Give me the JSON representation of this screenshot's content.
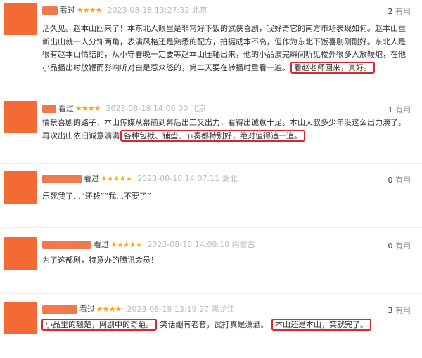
{
  "reviews": [
    {
      "watched": "看过",
      "stars": "★★★★",
      "meta": "2023-08-18 13:27:32 北京",
      "useful_count": "2",
      "useful_label": "有用",
      "text": "活久见。赵本山回来了！本东北人眼里是非常好下饭的武侠喜剧，我好奇它的南方市场表现如何。赵本山重新出山就一人分饰两角，表演风格还是熟悉的配方，拍摄成本不高，但作为东北下饭喜剧刚刚好。东北人是很有赵本山情结的，从小守春晚一定要等赵本山压轴出来，他的小品演完瞬间听见楼外很多人放鞭炮，在他小品播出时放鞭而影响听对白是惹众怒的，第二天要在转播时重看一遍。",
      "highlight": "看赵老师回来，真好。"
    },
    {
      "watched": "看过",
      "stars": "★★★★",
      "meta": "2023-08-18 14:06:00 北京",
      "useful_count": "1",
      "useful_label": "有用",
      "text": "情景喜剧的路子，本山传媒从幕前到幕后出工又出力，看得出诚意十足。本山大叔多少年没这么出力演了，再次出山依旧诚意满满",
      "highlight": "各种包袱、铺垫、节奏都特别好，绝对值得追一追。"
    },
    {
      "watched": "看过",
      "stars": "★★★★★",
      "meta": "2023-08-18 14:07:11 湖北",
      "useful_count": "0",
      "useful_label": "有用",
      "text": "乐死我了…“还钱”“我…不要了”"
    },
    {
      "watched": "看过",
      "stars": "★★★★★",
      "meta": "2023-08-18 14:09:18 内蒙古",
      "useful_count": "0",
      "useful_label": "有用",
      "text": "为了这部剧，特意办的腾讯会员！"
    },
    {
      "watched": "看过",
      "stars": "★★★★",
      "meta": "2023-08-18 13:19:27 黑龙江",
      "useful_count": "3",
      "useful_label": "有用",
      "hl1": "小品里的翘楚，网剧中的奇葩。",
      "mid": "笑话绷有老套，武打真是潇洒。",
      "hl2": "本山还是本山，笑就完了。"
    }
  ],
  "colors": {
    "avatar": "#f46a34",
    "star": "#f5a623",
    "highlight_border": "#d9272d"
  }
}
